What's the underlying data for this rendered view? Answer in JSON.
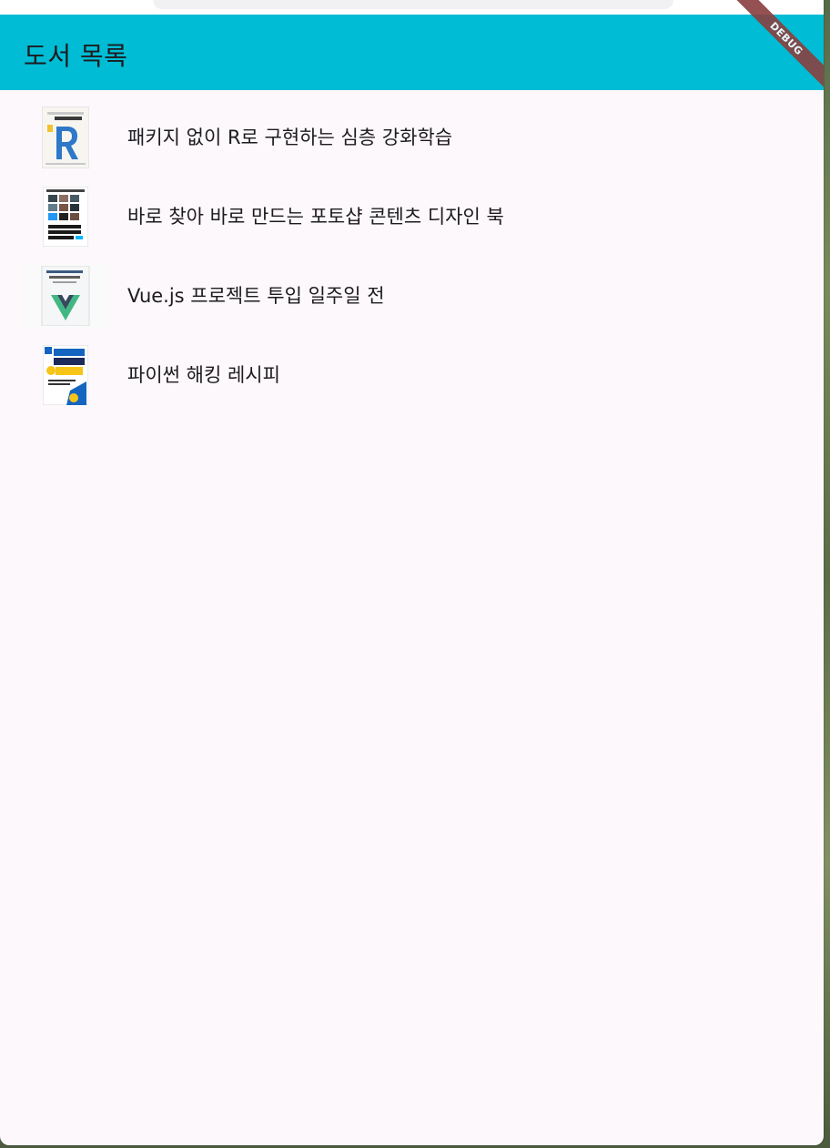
{
  "appbar": {
    "title": "도서 목록",
    "debug_banner": "DEBUG",
    "color": "#00bcd4"
  },
  "books": [
    {
      "title": "패키지 없이 R로 구현하는 심층 강화학습",
      "cover_icon": "book-cover-r-icon"
    },
    {
      "title": "바로 찾아 바로 만드는 포토샵 콘텐츠 디자인 북",
      "cover_icon": "book-cover-photoshop-icon"
    },
    {
      "title": "Vue.js 프로젝트 투입 일주일 전",
      "cover_icon": "book-cover-vue-icon"
    },
    {
      "title": "파이썬 해킹 레시피",
      "cover_icon": "book-cover-python-icon"
    }
  ]
}
